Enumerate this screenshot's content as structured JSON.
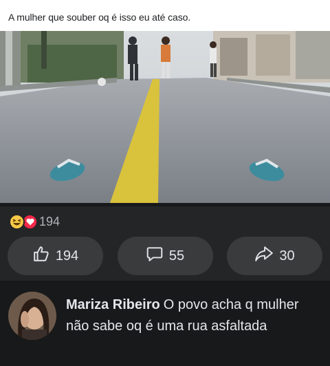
{
  "post": {
    "caption": "A mulher que souber oq é isso eu até caso."
  },
  "reactions": {
    "types": [
      "haha",
      "love"
    ],
    "count": "194"
  },
  "actions": {
    "like_count": "194",
    "comment_count": "55",
    "share_count": "30"
  },
  "comment": {
    "author": "Mariza Ribeiro",
    "text": "O povo acha q mulher não sabe oq é uma rua asfaltada"
  },
  "colors": {
    "background": "#18191a",
    "bar": "#242526",
    "pill": "#3a3b3c",
    "text": "#e4e6eb",
    "muted": "#b0b3b8",
    "love": "#f02849",
    "haha": "#f7c948"
  }
}
